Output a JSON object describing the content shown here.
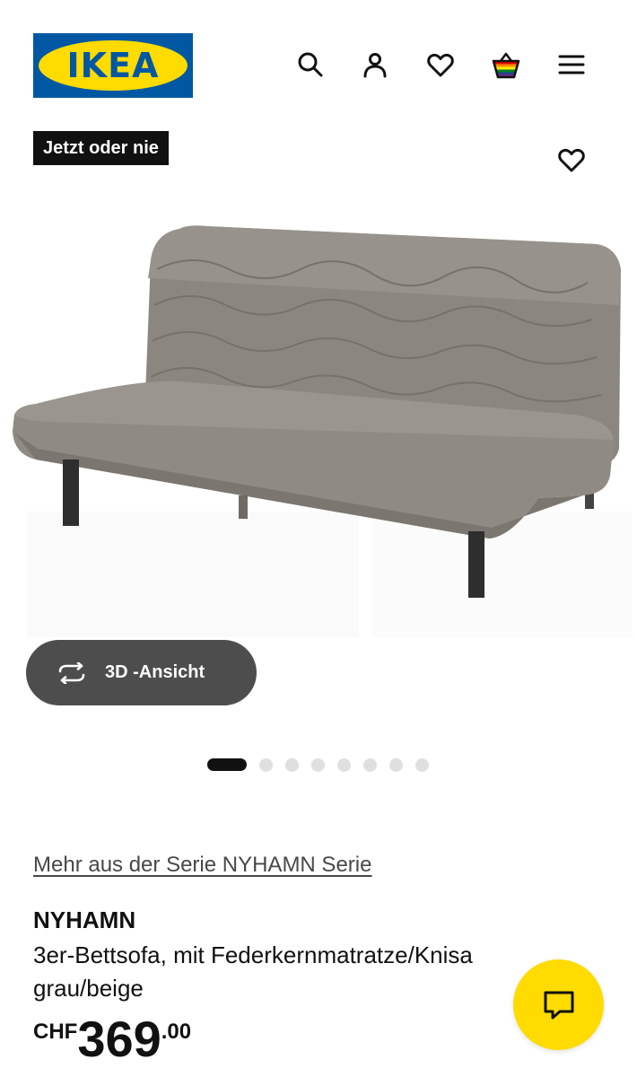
{
  "header": {
    "logo_text": "IKEA",
    "logo_mark": "®",
    "icons": [
      "search-icon",
      "user-icon",
      "heart-icon",
      "shopping-bag-icon",
      "menu-icon"
    ]
  },
  "product": {
    "badge": "Jetzt oder nie",
    "series_link": "Mehr aus der Serie NYHAMN Serie",
    "name": "NYHAMN",
    "description": "3er-Bettsofa, mit Federkernmatratze/Knisa grau/beige",
    "price": {
      "currency": "CHF",
      "integer": "369",
      "decimal": ".00"
    }
  },
  "gallery": {
    "view_3d_label": "3D -Ansicht",
    "dots_total": 8,
    "active_index": 0
  },
  "colors": {
    "ikea_blue": "#0058a3",
    "ikea_yellow": "#ffdb00",
    "button_dark": "#4d4d4d"
  }
}
